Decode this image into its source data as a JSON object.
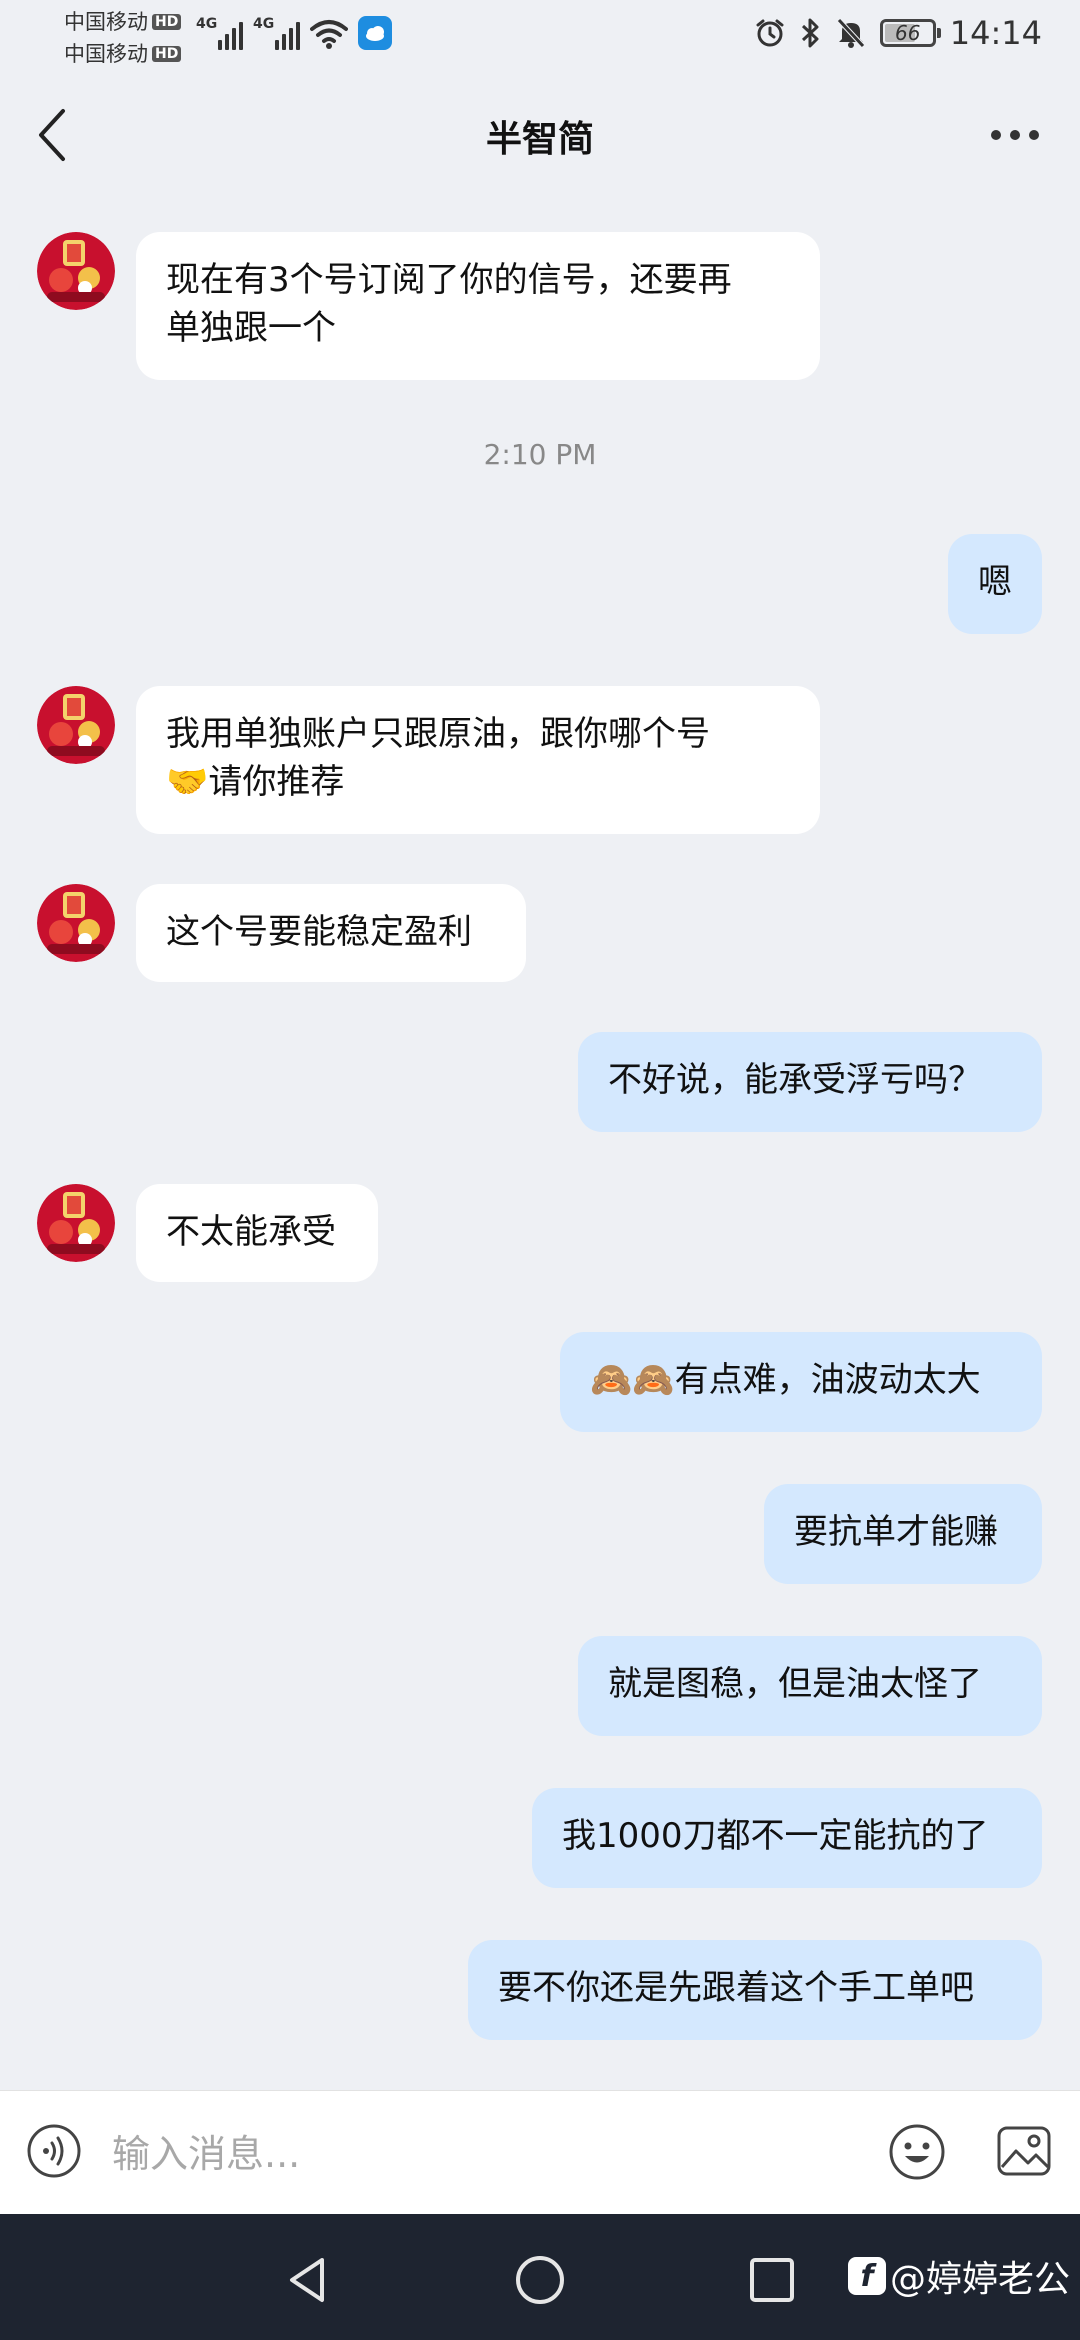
{
  "status_bar": {
    "carrier_1": "中国移动",
    "carrier_2": "中国移动",
    "hd_label": "HD",
    "network_1": "4G",
    "network_2": "4G",
    "battery_level": "66",
    "time": "14:14",
    "icons": [
      "signal-icon",
      "wifi-icon",
      "weather-app-icon",
      "alarm-icon",
      "bluetooth-icon",
      "mute-icon",
      "battery-icon"
    ]
  },
  "header": {
    "title": "半智简",
    "back_icon": "chevron-left-icon",
    "more_icon": "more-dots-icon"
  },
  "chat": {
    "messages": [
      {
        "direction": "in",
        "text_line1": "现在有3个号订阅了你的信号，还要再",
        "text_line2": "单独跟一个"
      },
      {
        "type": "timestamp",
        "text": "2:10 PM"
      },
      {
        "direction": "out",
        "text": "嗯"
      },
      {
        "direction": "in",
        "text_line1": "我用单独账户只跟原油，跟你哪个号",
        "text_line2": "🤝请你推荐"
      },
      {
        "direction": "in",
        "text": "这个号要能稳定盈利"
      },
      {
        "direction": "out",
        "text": "不好说，能承受浮亏吗？"
      },
      {
        "direction": "in",
        "text": "不太能承受"
      },
      {
        "direction": "out",
        "text": "🙈🙈有点难，油波动太大"
      },
      {
        "direction": "out",
        "text": "要抗单才能赚"
      },
      {
        "direction": "out",
        "text": "就是图稳，但是油太怪了"
      },
      {
        "direction": "out",
        "text": "我1000刀都不一定能抗的了"
      },
      {
        "direction": "out",
        "text": "要不你还是先跟着这个手工单吧"
      }
    ]
  },
  "input_bar": {
    "placeholder": "输入消息...",
    "value": "",
    "icons": [
      "voice-icon",
      "emoji-icon",
      "image-icon"
    ]
  },
  "nav_bar": {
    "icons": [
      "nav-back-icon",
      "nav-home-icon",
      "nav-recent-icon"
    ],
    "watermark": "@婷婷老公"
  },
  "colors": {
    "background": "#eef0f4",
    "incoming_bubble": "#ffffff",
    "outgoing_bubble": "#d4e8fe",
    "nav_bar": "#1e2430",
    "avatar": "#c8102e"
  }
}
